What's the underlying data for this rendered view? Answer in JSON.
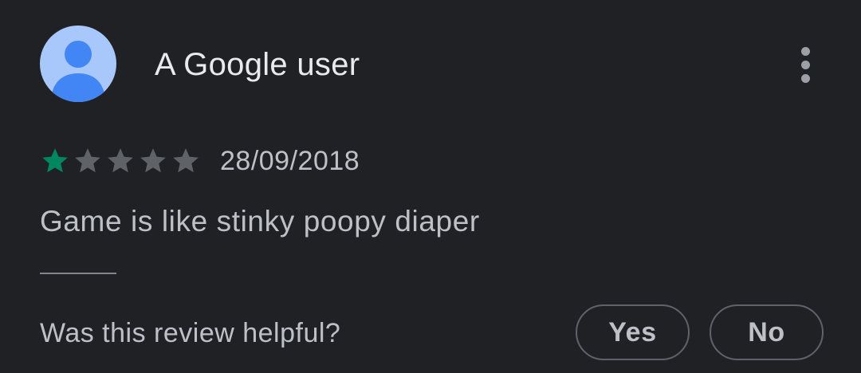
{
  "review": {
    "author": "A Google user",
    "avatar_icon": "person-icon",
    "more_icon": "more-vert-icon",
    "rating": 1,
    "max_rating": 5,
    "date": "28/09/2018",
    "text": "Game is like stinky poopy diaper"
  },
  "helpful": {
    "question": "Was this review helpful?",
    "yes_label": "Yes",
    "no_label": "No"
  },
  "colors": {
    "background": "#202124",
    "star_filled": "#01875f",
    "star_empty": "#5f6368",
    "avatar_bg": "#a8c7fa",
    "avatar_person": "#4285f4"
  }
}
